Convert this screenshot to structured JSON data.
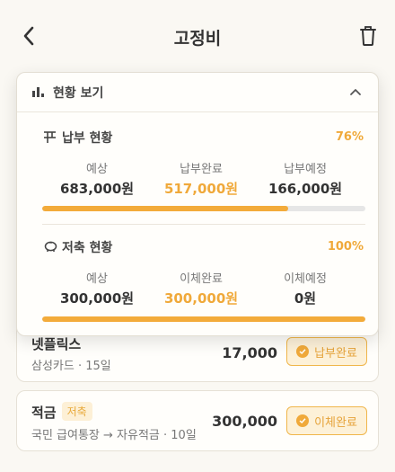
{
  "header": {
    "title": "고정비"
  },
  "panel": {
    "label": "현황 보기",
    "payment": {
      "title": "납부 현황",
      "percent": "76%",
      "progress": 0.76,
      "columns": [
        {
          "label": "예상",
          "value": "683,000원"
        },
        {
          "label": "납부완료",
          "value": "517,000원"
        },
        {
          "label": "납부예정",
          "value": "166,000원"
        }
      ]
    },
    "savings": {
      "title": "저축 현황",
      "percent": "100%",
      "progress": 1.0,
      "columns": [
        {
          "label": "예상",
          "value": "300,000원"
        },
        {
          "label": "이체완료",
          "value": "300,000원"
        },
        {
          "label": "이체예정",
          "value": "0원"
        }
      ]
    }
  },
  "items": [
    {
      "name": "넷플릭스",
      "sub": "삼성카드 · 15일",
      "amount": "17,000",
      "status": "납부완료"
    },
    {
      "name": "적금",
      "tag": "저축",
      "sub": "국민 급여통장 → 자유적금 · 10일",
      "amount": "300,000",
      "status": "이체완료"
    }
  ],
  "colors": {
    "accent": "#f0a93a",
    "track": "#e6e6e6"
  }
}
